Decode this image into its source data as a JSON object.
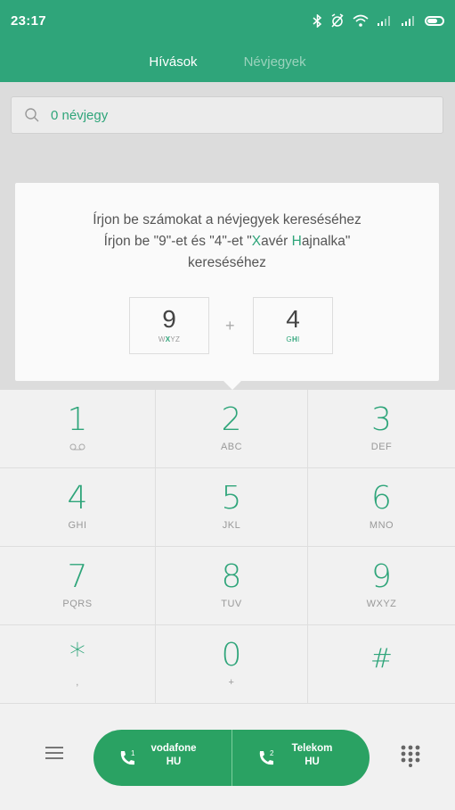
{
  "status_bar": {
    "time": "23:17"
  },
  "tabs": [
    {
      "label": "Hívások",
      "active": true
    },
    {
      "label": "Névjegyek",
      "active": false
    }
  ],
  "search": {
    "placeholder": "0 névjegy"
  },
  "hint_card": {
    "line1": "Írjon be számokat a névjegyek kereséséhez",
    "line2_prefix": "Írjon be \"9\"-et és \"4\"-et \"",
    "line2_x": "X",
    "line2_mid": "avér ",
    "line2_h": "H",
    "line2_suffix": "ajnalka\"",
    "line3": "kereséséhez",
    "example_keys": [
      {
        "digit": "9",
        "letters_pre": "W",
        "letters_hl": "X",
        "letters_post": "YZ"
      },
      {
        "digit": "4",
        "letters_pre": "G",
        "letters_hl": "H",
        "letters_post": "I"
      }
    ],
    "plus": "+"
  },
  "keypad": [
    {
      "digit": "1",
      "sub": ""
    },
    {
      "digit": "2",
      "sub": "ABC"
    },
    {
      "digit": "3",
      "sub": "DEF"
    },
    {
      "digit": "4",
      "sub": "GHI"
    },
    {
      "digit": "5",
      "sub": "JKL"
    },
    {
      "digit": "6",
      "sub": "MNO"
    },
    {
      "digit": "7",
      "sub": "PQRS"
    },
    {
      "digit": "8",
      "sub": "TUV"
    },
    {
      "digit": "9",
      "sub": "WXYZ"
    },
    {
      "digit": "*",
      "sub": ","
    },
    {
      "digit": "0",
      "sub": "+"
    },
    {
      "digit": "#",
      "sub": ""
    }
  ],
  "call_buttons": [
    {
      "sim": "1",
      "line1": "vodafone",
      "line2": "HU"
    },
    {
      "sim": "2",
      "line1": "Telekom",
      "line2": "HU"
    }
  ],
  "colors": {
    "accent": "#2fa57a",
    "call_button": "#2aa263"
  }
}
